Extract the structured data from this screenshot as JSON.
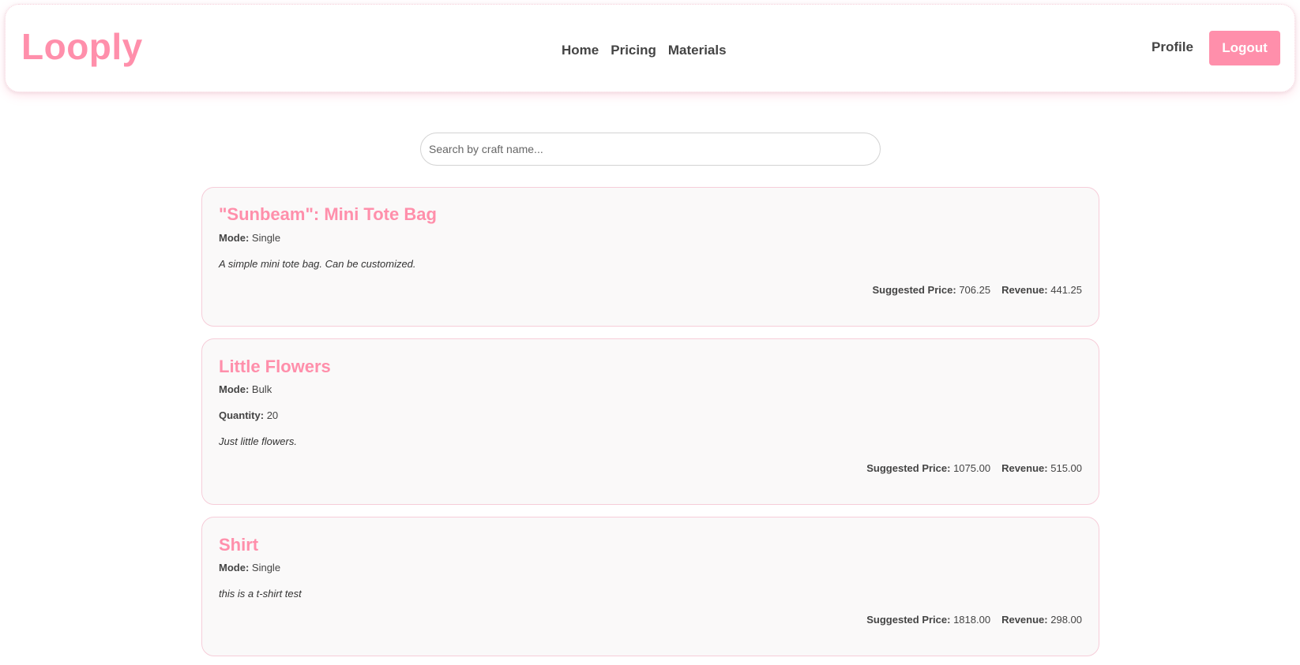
{
  "app": {
    "logo": "Looply"
  },
  "nav": {
    "links": [
      "Home",
      "Pricing",
      "Materials"
    ],
    "profile": "Profile",
    "logout": "Logout"
  },
  "search": {
    "placeholder": "Search by craft name...",
    "value": ""
  },
  "labels": {
    "mode": "Mode:",
    "quantity": "Quantity:",
    "suggested_price": "Suggested Price:",
    "revenue": "Revenue:"
  },
  "crafts": [
    {
      "title": "\"Sunbeam\": Mini Tote Bag",
      "mode": "Single",
      "description": "A simple mini tote bag. Can be customized.",
      "suggested_price": "706.25",
      "revenue": "441.25"
    },
    {
      "title": "Little Flowers",
      "mode": "Bulk",
      "quantity": "20",
      "description": "Just little flowers.",
      "suggested_price": "1075.00",
      "revenue": "515.00"
    },
    {
      "title": "Shirt",
      "mode": "Single",
      "description": "this is a t-shirt test",
      "suggested_price": "1818.00",
      "revenue": "298.00"
    }
  ],
  "colors": {
    "accent": "#ff8fab",
    "text": "#444444",
    "card_bg": "#faf9f9",
    "card_border": "#f6cdd9"
  }
}
